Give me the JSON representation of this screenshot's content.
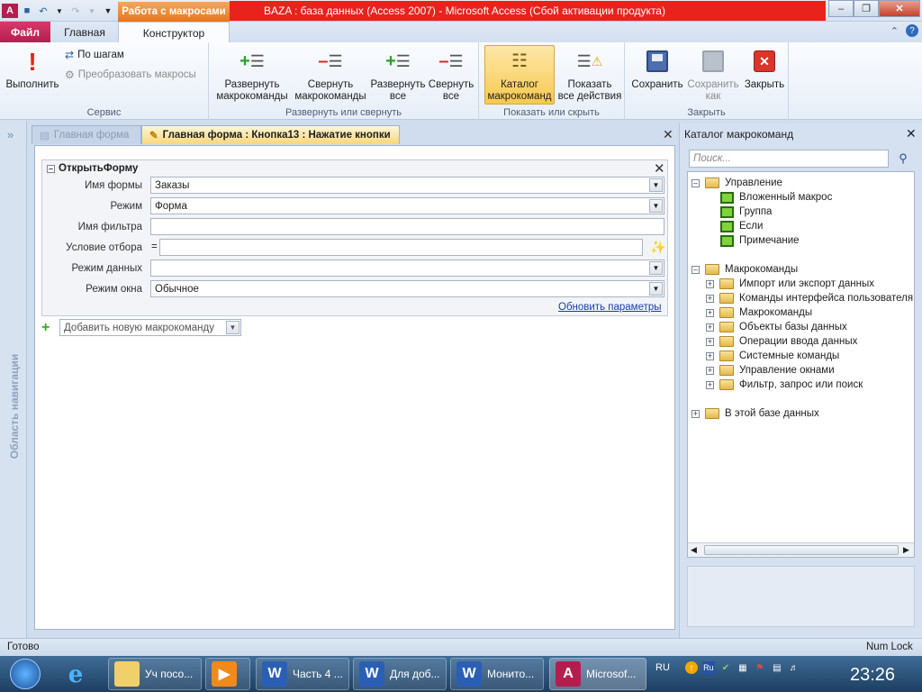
{
  "title_bar": {
    "context_tab": "Работа с макросами",
    "title": "BAZA : база данных (Access 2007)  -  Microsoft Access (Сбой активации продукта)"
  },
  "tabs": [
    "Файл",
    "Главная",
    "Конструктор"
  ],
  "ribbon": {
    "groups": {
      "service": "Сервис",
      "expand": "Развернуть или свернуть",
      "show": "Показать или скрыть",
      "close": "Закрыть"
    },
    "buttons": {
      "run": "Выполнить",
      "step": "По шагам",
      "convert": "Преобразовать макросы",
      "expand_actions_1": "Развернуть",
      "expand_actions_2": "макрокоманды",
      "collapse_actions_1": "Свернуть",
      "collapse_actions_2": "макрокоманды",
      "expand_all_1": "Развернуть",
      "expand_all_2": "все",
      "collapse_all_1": "Свернуть",
      "collapse_all_2": "все",
      "catalog_1": "Каталог",
      "catalog_2": "макрокоманд",
      "show_all_1": "Показать",
      "show_all_2": "все действия",
      "save": "Сохранить",
      "save_as_1": "Сохранить",
      "save_as_2": "как",
      "close": "Закрыть"
    }
  },
  "nav_pane": {
    "label": "Область навигации"
  },
  "doc_tabs": {
    "main_form": "Главная форма",
    "macro": "Главная форма : Кнопка13 : Нажатие кнопки"
  },
  "action": {
    "name": "ОткрытьФорму",
    "args": {
      "form_name_label": "Имя формы",
      "form_name": "Заказы",
      "mode_label": "Режим",
      "mode": "Форма",
      "filter_label": "Имя фильтра",
      "filter": "",
      "where_label": "Условие отбора",
      "where_prefix": "=",
      "where": "",
      "data_mode_label": "Режим данных",
      "data_mode": "",
      "window_mode_label": "Режим окна",
      "window_mode": "Обычное"
    },
    "update_link": "Обновить параметры"
  },
  "add_action_placeholder": "Добавить новую макрокоманду",
  "catalog": {
    "title": "Каталог макрокоманд",
    "search_placeholder": "Поиск...",
    "sections": [
      {
        "label": "Управление",
        "items": [
          "Вложенный макрос",
          "Группа",
          "Если",
          "Примечание"
        ]
      },
      {
        "label": "Макрокоманды",
        "items": [
          "Импорт или экспорт данных",
          "Команды интерфейса пользователя",
          "Макрокоманды",
          "Объекты базы данных",
          "Операции ввода данных",
          "Системные команды",
          "Управление окнами",
          "Фильтр, запрос или поиск"
        ]
      },
      {
        "label": "В этой базе данных",
        "items": []
      }
    ]
  },
  "status": {
    "left": "Готово",
    "right": "Num Lock"
  },
  "taskbar": {
    "items": [
      "Уч посо...",
      "Часть 4 ...",
      "Для доб...",
      "Монито...",
      "Microsof..."
    ],
    "lang": "RU",
    "clock": "23:26"
  },
  "colors": {
    "title_red": "#e7231c",
    "context_orange": "#e8761c",
    "file_tab": "#b41e4f",
    "link_blue": "#1a3fa8"
  }
}
